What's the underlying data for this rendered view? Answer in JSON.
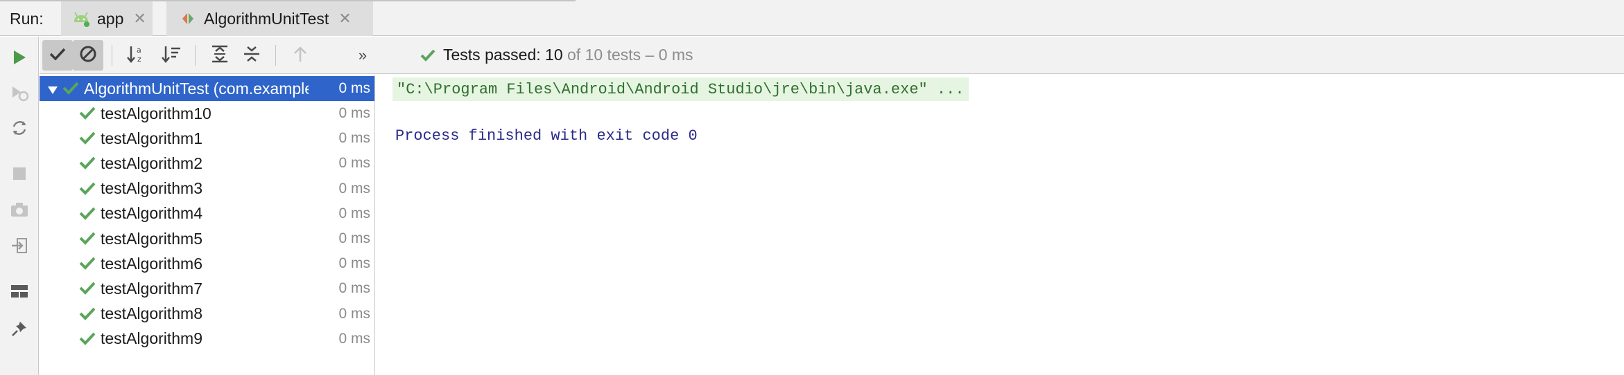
{
  "run_label": "Run:",
  "tabs": [
    {
      "label": "app",
      "icon": "android-icon",
      "close": "✕"
    },
    {
      "label": "AlgorithmUnitTest",
      "icon": "test-diamond-icon",
      "close": "✕"
    }
  ],
  "toolbar": {
    "more": "»"
  },
  "status": {
    "prefix": "Tests passed: ",
    "passed": "10",
    "suffix": " of 10 tests – 0 ms"
  },
  "tree": {
    "root": {
      "name": "AlgorithmUnitTest (com.example",
      "duration": "0 ms"
    },
    "tests": [
      {
        "name": "testAlgorithm10",
        "duration": "0 ms"
      },
      {
        "name": "testAlgorithm1",
        "duration": "0 ms"
      },
      {
        "name": "testAlgorithm2",
        "duration": "0 ms"
      },
      {
        "name": "testAlgorithm3",
        "duration": "0 ms"
      },
      {
        "name": "testAlgorithm4",
        "duration": "0 ms"
      },
      {
        "name": "testAlgorithm5",
        "duration": "0 ms"
      },
      {
        "name": "testAlgorithm6",
        "duration": "0 ms"
      },
      {
        "name": "testAlgorithm7",
        "duration": "0 ms"
      },
      {
        "name": "testAlgorithm8",
        "duration": "0 ms"
      },
      {
        "name": "testAlgorithm9",
        "duration": "0 ms"
      }
    ]
  },
  "console": {
    "command": "\"C:\\Program Files\\Android\\Android Studio\\jre\\bin\\java.exe\" ...",
    "exit": "Process finished with exit code 0"
  },
  "colors": {
    "pass_green": "#5aa55a",
    "selection_blue": "#2f65ca",
    "command_bg": "#e6f5e1",
    "exit_text": "#2b2b8a"
  }
}
